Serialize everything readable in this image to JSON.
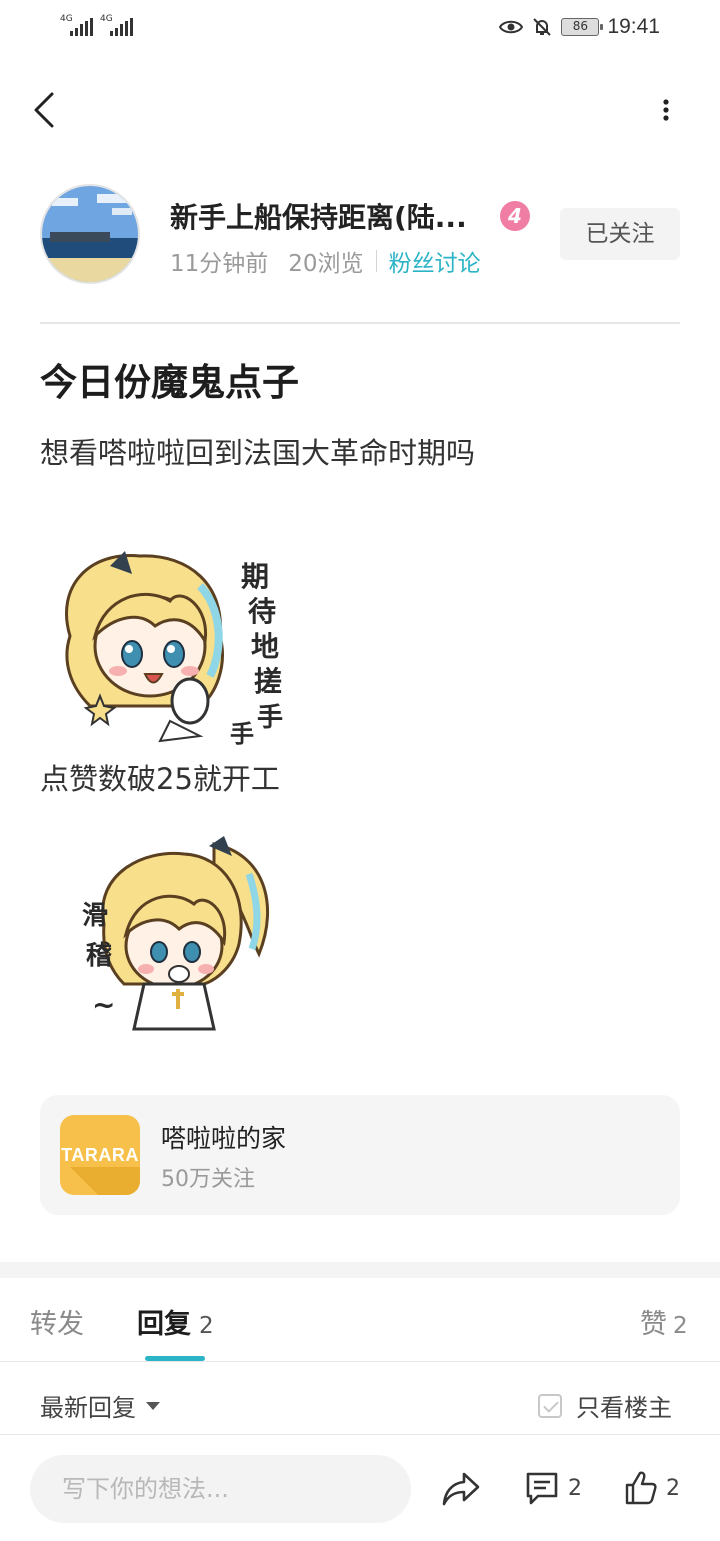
{
  "status_bar": {
    "signal_1": "4G",
    "signal_2": "4G",
    "battery": "86",
    "time": "19:41"
  },
  "nav": {
    "back_icon": "chevron-left-icon",
    "more_icon": "more-vertical-icon"
  },
  "author": {
    "name": "新手上船保持距离(陆...",
    "level": "4",
    "time_ago": "11分钟前",
    "views": "20浏览",
    "board": "粉丝讨论",
    "follow_label": "已关注"
  },
  "post": {
    "title": "今日份魔鬼点子",
    "paragraph_1": "想看嗒啦啦回到法国大革命时期吗",
    "sticker_1_text": "期待地搓手手",
    "paragraph_2": "点赞数破25就开工",
    "sticker_2_text": "滑稽~"
  },
  "board_card": {
    "logo_text": "TARARA",
    "name": "嗒啦啦的家",
    "followers": "50万关注"
  },
  "tabs": {
    "repost": "转发",
    "reply": "回复",
    "reply_count": "2",
    "like": "赞",
    "like_count": "2"
  },
  "sort": {
    "label": "最新回复",
    "only_op": "只看楼主"
  },
  "bottom_bar": {
    "placeholder": "写下你的想法...",
    "comments_count": "2",
    "likes_count": "2"
  },
  "colors": {
    "accent": "#2bb4c6",
    "level_badge": "#f07da3",
    "board_logo": "#f7c04a"
  }
}
